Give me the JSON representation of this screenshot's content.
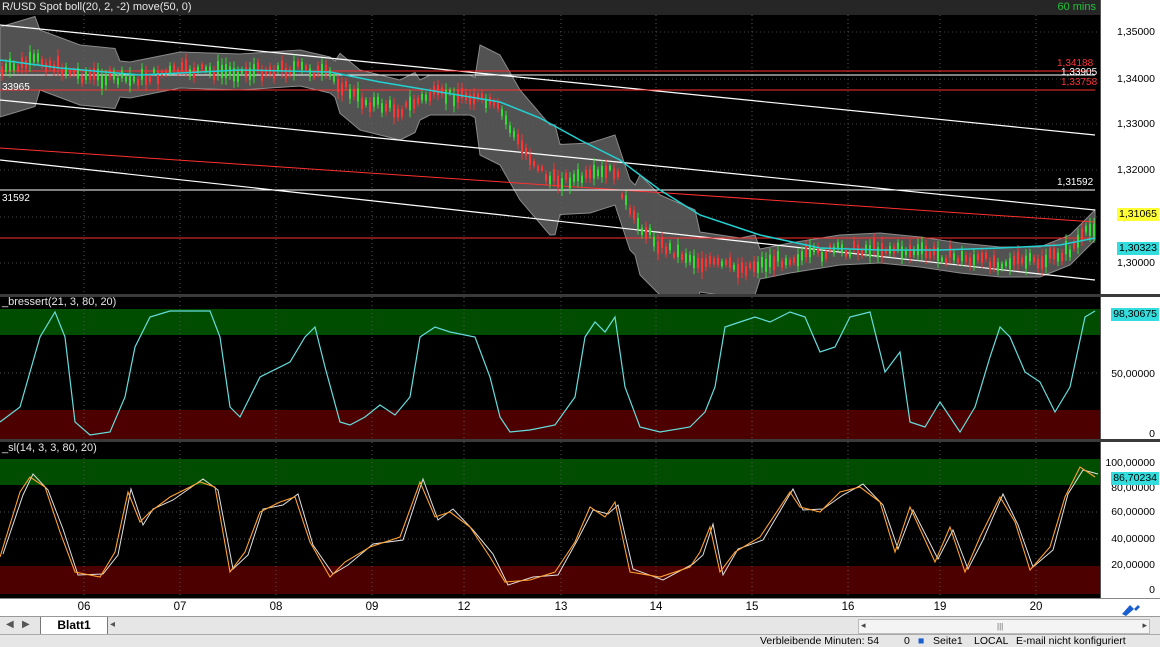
{
  "window": {
    "interval": "60 mins"
  },
  "price_panel": {
    "title": "R/USD Spot boll(20, 2, -2) move(50, 0)",
    "axis_ticks": [
      "1,35000",
      "1,34000",
      "1,33000",
      "1,32000",
      "1,31000",
      "1,30000"
    ],
    "price_boxes": [
      {
        "text": "1,31065",
        "bg": "#ffff33"
      },
      {
        "text": "1,30323",
        "bg": "#33dddd"
      }
    ],
    "right_labels": [
      {
        "text": "1,34188",
        "color": "#ff3333"
      },
      {
        "text": "1,33905",
        "color": "#ffffff"
      },
      {
        "text": "1,33758",
        "color": "#ff3333"
      },
      {
        "text": "1,31592",
        "color": "#ffffff"
      }
    ],
    "left_labels": [
      {
        "text": "33965",
        "color": "#ffffff"
      },
      {
        "text": "31592",
        "color": "#ffffff"
      }
    ]
  },
  "ind1": {
    "title": "_bressert(21, 3, 80, 20)",
    "axis_ticks": [
      "50,00000",
      "0"
    ],
    "box": {
      "text": "98,30675",
      "bg": "#33dddd"
    }
  },
  "ind2": {
    "title": "_sl(14, 3, 3, 80, 20)",
    "axis_ticks": [
      "100,00000",
      "80,00000",
      "60,00000",
      "40,00000",
      "20,00000",
      "0"
    ],
    "box": {
      "text": "86,70234",
      "bg": "#33dddd"
    }
  },
  "x_axis": {
    "labels": [
      "06",
      "07",
      "08",
      "09",
      "12",
      "13",
      "14",
      "15",
      "16",
      "19",
      "20"
    ]
  },
  "tabs": {
    "sheet": "Blatt1"
  },
  "status": {
    "remaining": "Verbleibende Minuten: 54",
    "count": "0",
    "page": "Seite1",
    "mode": "LOCAL",
    "email": "E-mail nicht konfiguriert"
  },
  "colors": {
    "bollinger_band": "#606060",
    "moving_avg": "#22d2d2",
    "stoch_k": "#ffa030",
    "stoch_d": "#e0e0e0",
    "overbought_zone": "#004d00",
    "oversold_zone": "#4d0000",
    "resistance": "#ff3030",
    "trendline": "#ffffff"
  },
  "icons": {
    "scroll_left": "triangle-left",
    "scroll_right": "triangle-right",
    "draw_tool": "pen-icon"
  }
}
